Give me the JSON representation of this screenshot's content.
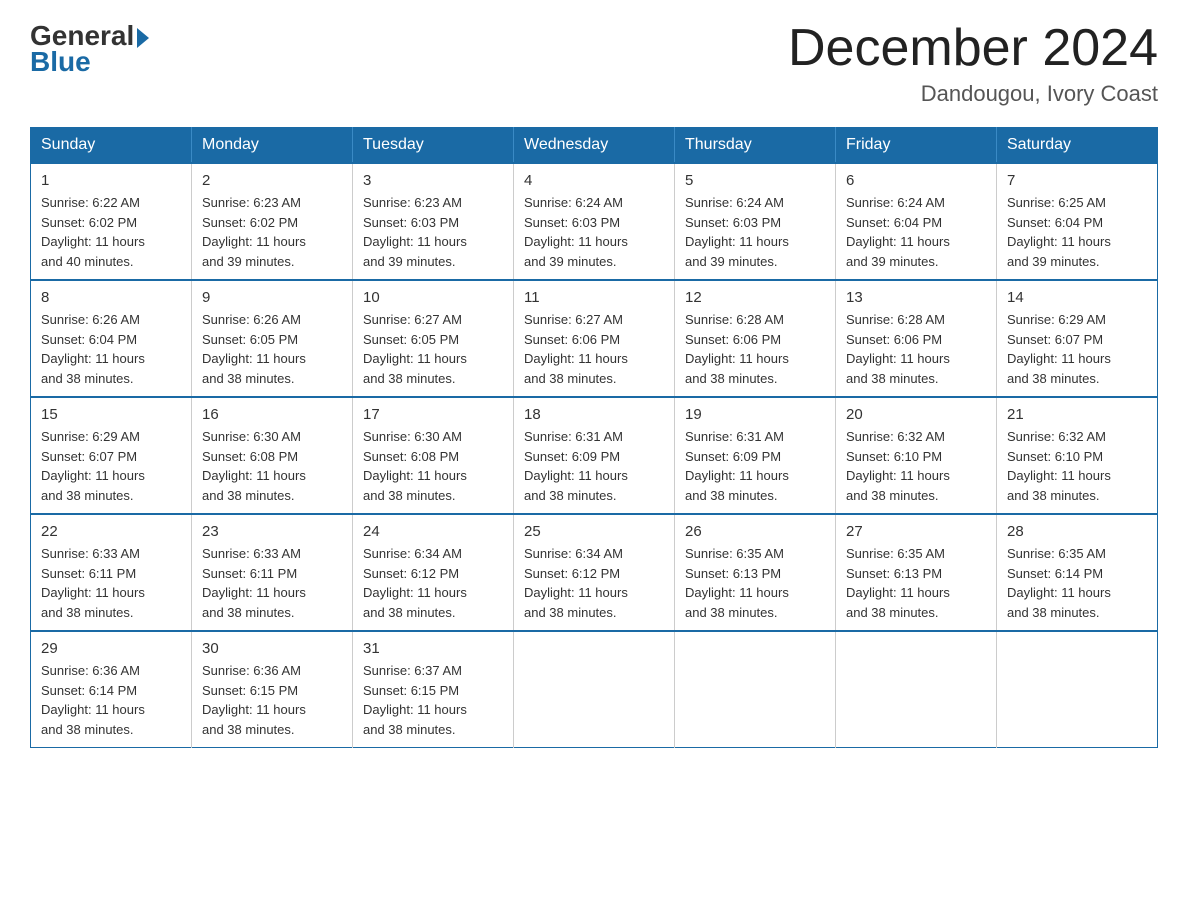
{
  "logo": {
    "general": "General",
    "blue": "Blue"
  },
  "title": "December 2024",
  "location": "Dandougou, Ivory Coast",
  "days_of_week": [
    "Sunday",
    "Monday",
    "Tuesday",
    "Wednesday",
    "Thursday",
    "Friday",
    "Saturday"
  ],
  "weeks": [
    [
      {
        "day": "1",
        "sunrise": "6:22 AM",
        "sunset": "6:02 PM",
        "daylight": "11 hours and 40 minutes."
      },
      {
        "day": "2",
        "sunrise": "6:23 AM",
        "sunset": "6:02 PM",
        "daylight": "11 hours and 39 minutes."
      },
      {
        "day": "3",
        "sunrise": "6:23 AM",
        "sunset": "6:03 PM",
        "daylight": "11 hours and 39 minutes."
      },
      {
        "day": "4",
        "sunrise": "6:24 AM",
        "sunset": "6:03 PM",
        "daylight": "11 hours and 39 minutes."
      },
      {
        "day": "5",
        "sunrise": "6:24 AM",
        "sunset": "6:03 PM",
        "daylight": "11 hours and 39 minutes."
      },
      {
        "day": "6",
        "sunrise": "6:24 AM",
        "sunset": "6:04 PM",
        "daylight": "11 hours and 39 minutes."
      },
      {
        "day": "7",
        "sunrise": "6:25 AM",
        "sunset": "6:04 PM",
        "daylight": "11 hours and 39 minutes."
      }
    ],
    [
      {
        "day": "8",
        "sunrise": "6:26 AM",
        "sunset": "6:04 PM",
        "daylight": "11 hours and 38 minutes."
      },
      {
        "day": "9",
        "sunrise": "6:26 AM",
        "sunset": "6:05 PM",
        "daylight": "11 hours and 38 minutes."
      },
      {
        "day": "10",
        "sunrise": "6:27 AM",
        "sunset": "6:05 PM",
        "daylight": "11 hours and 38 minutes."
      },
      {
        "day": "11",
        "sunrise": "6:27 AM",
        "sunset": "6:06 PM",
        "daylight": "11 hours and 38 minutes."
      },
      {
        "day": "12",
        "sunrise": "6:28 AM",
        "sunset": "6:06 PM",
        "daylight": "11 hours and 38 minutes."
      },
      {
        "day": "13",
        "sunrise": "6:28 AM",
        "sunset": "6:06 PM",
        "daylight": "11 hours and 38 minutes."
      },
      {
        "day": "14",
        "sunrise": "6:29 AM",
        "sunset": "6:07 PM",
        "daylight": "11 hours and 38 minutes."
      }
    ],
    [
      {
        "day": "15",
        "sunrise": "6:29 AM",
        "sunset": "6:07 PM",
        "daylight": "11 hours and 38 minutes."
      },
      {
        "day": "16",
        "sunrise": "6:30 AM",
        "sunset": "6:08 PM",
        "daylight": "11 hours and 38 minutes."
      },
      {
        "day": "17",
        "sunrise": "6:30 AM",
        "sunset": "6:08 PM",
        "daylight": "11 hours and 38 minutes."
      },
      {
        "day": "18",
        "sunrise": "6:31 AM",
        "sunset": "6:09 PM",
        "daylight": "11 hours and 38 minutes."
      },
      {
        "day": "19",
        "sunrise": "6:31 AM",
        "sunset": "6:09 PM",
        "daylight": "11 hours and 38 minutes."
      },
      {
        "day": "20",
        "sunrise": "6:32 AM",
        "sunset": "6:10 PM",
        "daylight": "11 hours and 38 minutes."
      },
      {
        "day": "21",
        "sunrise": "6:32 AM",
        "sunset": "6:10 PM",
        "daylight": "11 hours and 38 minutes."
      }
    ],
    [
      {
        "day": "22",
        "sunrise": "6:33 AM",
        "sunset": "6:11 PM",
        "daylight": "11 hours and 38 minutes."
      },
      {
        "day": "23",
        "sunrise": "6:33 AM",
        "sunset": "6:11 PM",
        "daylight": "11 hours and 38 minutes."
      },
      {
        "day": "24",
        "sunrise": "6:34 AM",
        "sunset": "6:12 PM",
        "daylight": "11 hours and 38 minutes."
      },
      {
        "day": "25",
        "sunrise": "6:34 AM",
        "sunset": "6:12 PM",
        "daylight": "11 hours and 38 minutes."
      },
      {
        "day": "26",
        "sunrise": "6:35 AM",
        "sunset": "6:13 PM",
        "daylight": "11 hours and 38 minutes."
      },
      {
        "day": "27",
        "sunrise": "6:35 AM",
        "sunset": "6:13 PM",
        "daylight": "11 hours and 38 minutes."
      },
      {
        "day": "28",
        "sunrise": "6:35 AM",
        "sunset": "6:14 PM",
        "daylight": "11 hours and 38 minutes."
      }
    ],
    [
      {
        "day": "29",
        "sunrise": "6:36 AM",
        "sunset": "6:14 PM",
        "daylight": "11 hours and 38 minutes."
      },
      {
        "day": "30",
        "sunrise": "6:36 AM",
        "sunset": "6:15 PM",
        "daylight": "11 hours and 38 minutes."
      },
      {
        "day": "31",
        "sunrise": "6:37 AM",
        "sunset": "6:15 PM",
        "daylight": "11 hours and 38 minutes."
      },
      null,
      null,
      null,
      null
    ]
  ],
  "labels": {
    "sunrise": "Sunrise:",
    "sunset": "Sunset:",
    "daylight": "Daylight:"
  }
}
